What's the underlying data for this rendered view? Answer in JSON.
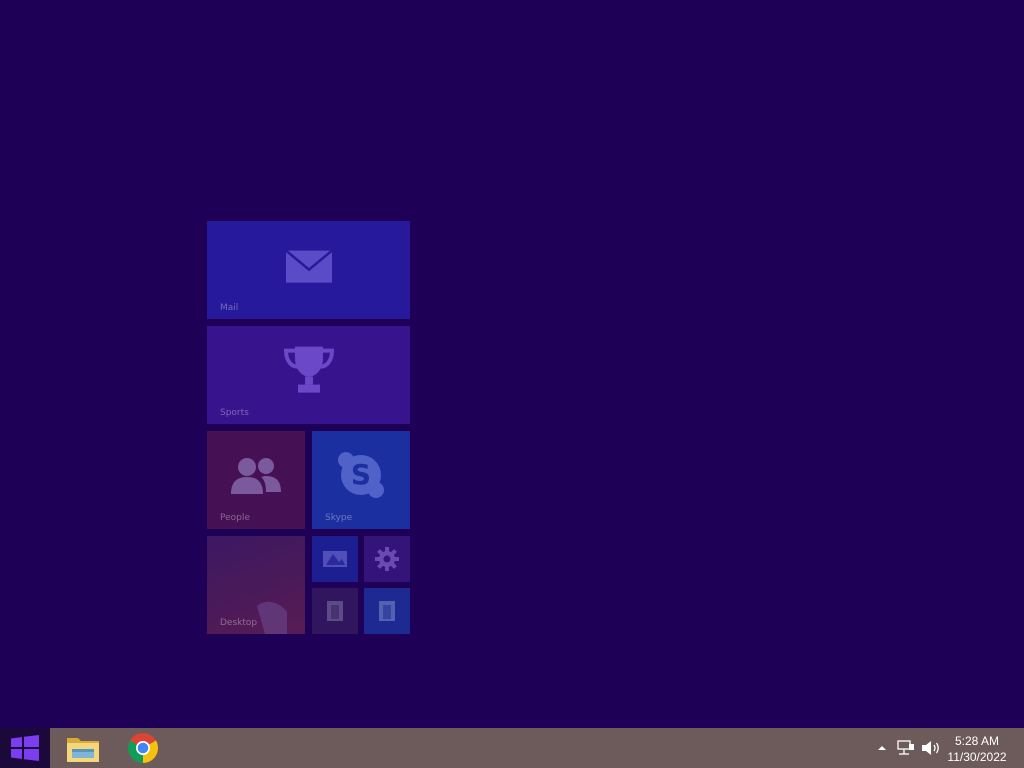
{
  "desktop": {
    "background_color": "#1e0056"
  },
  "start_tiles": [
    {
      "id": "mail",
      "label": "Mail",
      "color": "#27199b",
      "icon": "envelope-icon"
    },
    {
      "id": "sports",
      "label": "Sports",
      "color": "#37138e",
      "icon": "trophy-icon"
    },
    {
      "id": "people",
      "label": "People",
      "color": "#461154",
      "icon": "people-icon"
    },
    {
      "id": "skype",
      "label": "Skype",
      "color": "#1b2fa0",
      "icon": "skype-icon"
    },
    {
      "id": "desktop",
      "label": "Desktop",
      "color": "#4a1a58",
      "icon": "desktop-background"
    },
    {
      "id": "photos",
      "label": "",
      "color": "#1e1e93",
      "icon": "photo-icon"
    },
    {
      "id": "settings",
      "label": "",
      "color": "#341478",
      "icon": "gear-icon"
    },
    {
      "id": "documents",
      "label": "",
      "color": "#32155f",
      "icon": "file-explorer-icon"
    },
    {
      "id": "library",
      "label": "",
      "color": "#1e2a92",
      "icon": "file-explorer-icon"
    }
  ],
  "taskbar": {
    "background_color": "#6d5a5b",
    "start_icon": "windows-logo-icon",
    "pinned_apps": [
      {
        "name": "file-explorer",
        "icon": "folder-icon"
      },
      {
        "name": "chrome",
        "icon": "chrome-icon"
      }
    ],
    "tray_icons": [
      "show-hidden-icons-icon",
      "network-icon",
      "volume-icon"
    ],
    "time": "5:28 AM",
    "date": "11/30/2022"
  }
}
